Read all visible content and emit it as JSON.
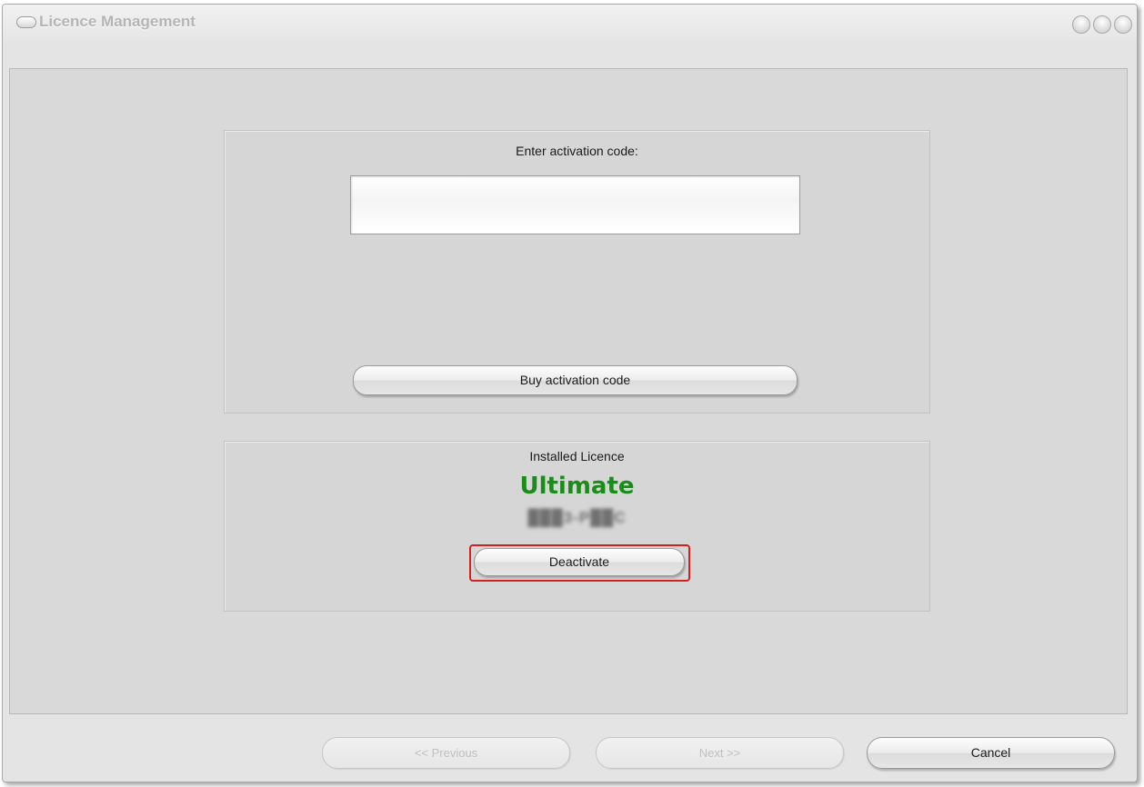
{
  "window": {
    "title": "Licence Management"
  },
  "activation": {
    "prompt": "Enter activation code:",
    "code_value": "",
    "buy_button": "Buy activation code"
  },
  "installed_licence": {
    "heading": "Installed Licence",
    "edition": "Ultimate",
    "key_masked": "███3-P██C",
    "deactivate_button": "Deactivate"
  },
  "footer": {
    "previous_label": "<< Previous",
    "next_label": "Next >>",
    "cancel_label": "Cancel",
    "previous_enabled": false,
    "next_enabled": false
  },
  "colors": {
    "edition_text": "#1a8c1a",
    "highlight_border": "#d81f1f"
  }
}
